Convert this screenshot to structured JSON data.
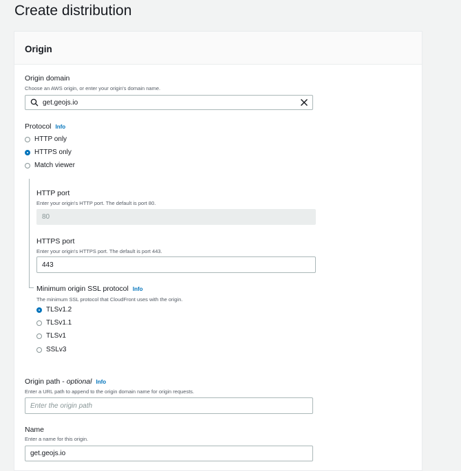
{
  "page": {
    "title": "Create distribution"
  },
  "origin_panel": {
    "title": "Origin"
  },
  "origin_domain": {
    "label": "Origin domain",
    "description": "Choose an AWS origin, or enter your origin's domain name.",
    "value": "get.geojs.io"
  },
  "protocol": {
    "label": "Protocol",
    "info": "Info",
    "options": [
      {
        "label": "HTTP only",
        "checked": false
      },
      {
        "label": "HTTPS only",
        "checked": true
      },
      {
        "label": "Match viewer",
        "checked": false
      }
    ]
  },
  "http_port": {
    "label": "HTTP port",
    "description": "Enter your origin's HTTP port. The default is port 80.",
    "value": "80"
  },
  "https_port": {
    "label": "HTTPS port",
    "description": "Enter your origin's HTTPS port. The default is port 443.",
    "value": "443"
  },
  "ssl_protocol": {
    "label": "Minimum origin SSL protocol",
    "info": "Info",
    "description": "The minimum SSL protocol that CloudFront uses with the origin.",
    "options": [
      {
        "label": "TLSv1.2",
        "checked": true
      },
      {
        "label": "TLSv1.1",
        "checked": false
      },
      {
        "label": "TLSv1",
        "checked": false
      },
      {
        "label": "SSLv3",
        "checked": false
      }
    ]
  },
  "origin_path": {
    "label": "Origin path - ",
    "label_optional": "optional",
    "info": "Info",
    "description": "Enter a URL path to append to the origin domain name for origin requests.",
    "placeholder": "Enter the origin path"
  },
  "name": {
    "label": "Name",
    "description": "Enter a name for this origin.",
    "value": "get.geojs.io"
  },
  "colors": {
    "accent": "#0073bb",
    "border": "#aab7b8",
    "disabled_bg": "#eaeded"
  }
}
